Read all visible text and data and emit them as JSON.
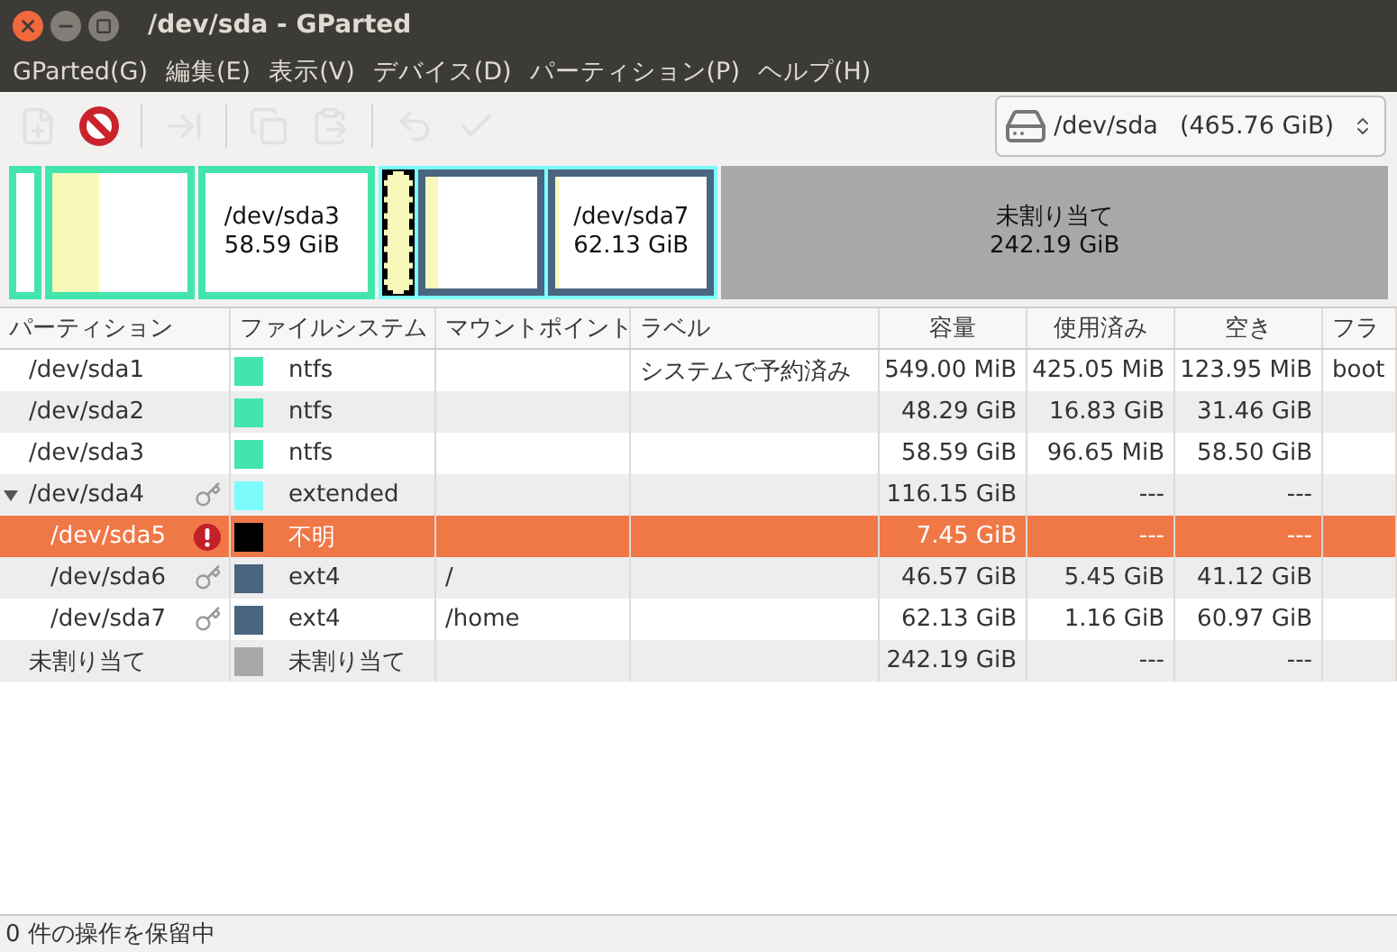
{
  "window": {
    "title": "/dev/sda - GParted"
  },
  "menu": [
    "GParted(G)",
    "編集(E)",
    "表示(V)",
    "デバイス(D)",
    "パーティション(P)",
    "ヘルプ(H)"
  ],
  "toolbar": [
    {
      "kind": "new",
      "disabled": true
    },
    {
      "kind": "delete",
      "disabled": false
    },
    {
      "kind": "resize",
      "disabled": true
    },
    {
      "kind": "copy",
      "disabled": true
    },
    {
      "kind": "paste",
      "disabled": true
    },
    {
      "kind": "undo",
      "disabled": true
    },
    {
      "kind": "apply",
      "disabled": true
    }
  ],
  "device": {
    "name": "/dev/sda",
    "size": "(465.76 GiB)"
  },
  "disk_map": [
    {
      "kind": "partition",
      "color": "#43e5ad"
    },
    {
      "kind": "partition",
      "color": "#43e5ad",
      "level": 0.35
    },
    {
      "kind": "partition",
      "color": "#43e5ad",
      "name": "/dev/sda3",
      "size": "58.59 GiB"
    },
    {
      "kind": "extended",
      "color": "#7dfcfe",
      "children": [
        {
          "kind": "unknown",
          "color": "#000000"
        },
        {
          "kind": "partition",
          "color": "#4a6580",
          "level": 0.12
        },
        {
          "kind": "partition",
          "color": "#4a6580",
          "level": 0.02,
          "name": "/dev/sda7",
          "size": "62.13 GiB"
        }
      ]
    },
    {
      "kind": "unallocated",
      "color": "#a8a8a8",
      "name": "未割り当て",
      "size": "242.19 GiB"
    }
  ],
  "table": {
    "columns": [
      "パーティション",
      "ファイルシステム",
      "マウントポイント",
      "ラベル",
      "容量",
      "使用済み",
      "空き",
      "フラ"
    ],
    "rows": [
      {
        "name": "/dev/sda1",
        "kind": "none",
        "color": "#43e5ad",
        "filesystem": "ntfs",
        "label": "システムで予約済み",
        "size": "549.00 MiB",
        "used": "425.05 MiB",
        "free": "123.95 MiB",
        "flags": "boot",
        "selected": false
      },
      {
        "name": "/dev/sda2",
        "kind": "none",
        "color": "#43e5ad",
        "filesystem": "ntfs",
        "size": "48.29 GiB",
        "used": "16.83 GiB",
        "free": "31.46 GiB",
        "selected": false
      },
      {
        "name": "/dev/sda3",
        "kind": "none",
        "color": "#43e5ad",
        "filesystem": "ntfs",
        "size": "58.59 GiB",
        "used": "96.65 MiB",
        "free": "58.50 GiB",
        "selected": false
      },
      {
        "name": "/dev/sda4",
        "kind": "key",
        "color": "#7dfcfe",
        "filesystem": "extended",
        "size": "116.15 GiB",
        "used": "---",
        "free": "---",
        "selected": false,
        "expanded": true,
        "children": [
          {
            "name": "/dev/sda5",
            "kind": "warning",
            "color": "#000000",
            "filesystem": "不明",
            "size": "7.45 GiB",
            "used": "---",
            "free": "---",
            "selected": true
          },
          {
            "name": "/dev/sda6",
            "kind": "key",
            "color": "#4a6580",
            "filesystem": "ext4",
            "mount": "/",
            "size": "46.57 GiB",
            "used": "5.45 GiB",
            "free": "41.12 GiB",
            "selected": false
          },
          {
            "name": "/dev/sda7",
            "kind": "key",
            "color": "#4a6580",
            "filesystem": "ext4",
            "mount": "/home",
            "size": "62.13 GiB",
            "used": "1.16 GiB",
            "free": "60.97 GiB",
            "selected": false
          }
        ]
      },
      {
        "name": "未割り当て",
        "kind": "none",
        "color": "#a8a8a8",
        "filesystem": "未割り当て",
        "size": "242.19 GiB",
        "used": "---",
        "free": "---",
        "selected": false
      }
    ]
  },
  "status_bar": "0 件の操作を保留中"
}
